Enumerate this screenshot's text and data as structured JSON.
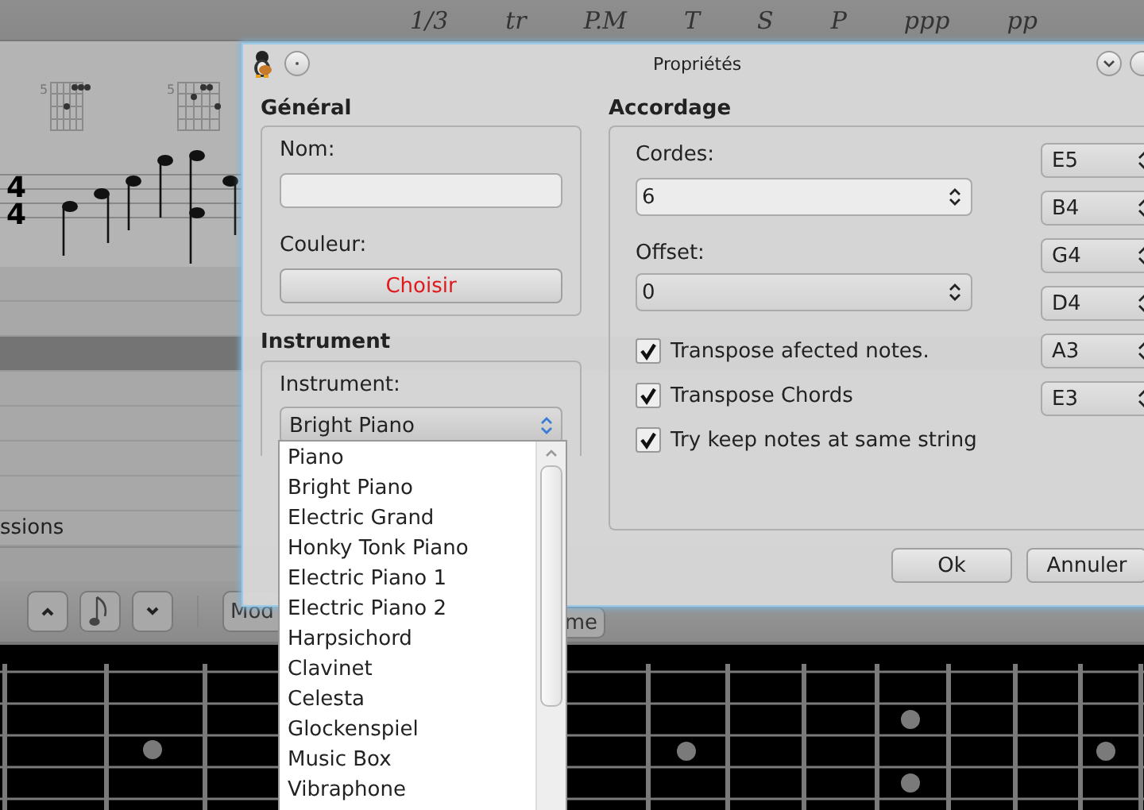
{
  "toolbar": {
    "items": [
      "1/3",
      "tr",
      "P.M",
      "T",
      "S",
      "P",
      "ppp",
      "pp"
    ]
  },
  "score": {
    "time_signature": [
      "4",
      "4"
    ],
    "chord_frets": [
      "5",
      "5"
    ]
  },
  "track_list": {
    "rows": [
      {
        "selected": false
      },
      {
        "selected": false
      },
      {
        "selected": true
      },
      {
        "selected": false
      },
      {
        "selected": false
      },
      {
        "selected": false
      },
      {
        "selected": false
      },
      {
        "name": "ssions",
        "selected": false
      }
    ]
  },
  "bottom_toolbar": {
    "buttons": [
      "Mod",
      "me"
    ]
  },
  "dialog": {
    "title": "Propriétés",
    "general": {
      "heading": "Général",
      "name_label": "Nom:",
      "color_label": "Couleur:",
      "color_button": "Choisir"
    },
    "instrument": {
      "heading": "Instrument",
      "label": "Instrument:",
      "value": "Bright Piano",
      "options": [
        "Piano",
        "Bright Piano",
        "Electric Grand",
        "Honky Tonk Piano",
        "Electric Piano 1",
        "Electric Piano 2",
        "Harpsichord",
        "Clavinet",
        "Celesta",
        "Glockenspiel",
        "Music Box",
        "Vibraphone"
      ]
    },
    "tuning": {
      "heading": "Accordage",
      "strings_label": "Cordes:",
      "strings_value": "6",
      "offset_label": "Offset:",
      "offset_value": "0",
      "notes": [
        "E5",
        "B4",
        "G4",
        "D4",
        "A3",
        "E3"
      ],
      "options": [
        {
          "label": "Transpose afected notes.",
          "checked": true
        },
        {
          "label": "Transpose Chords",
          "checked": true
        },
        {
          "label": "Try keep notes at same string",
          "checked": true
        }
      ]
    },
    "buttons": [
      "Ok",
      "Annuler"
    ]
  }
}
